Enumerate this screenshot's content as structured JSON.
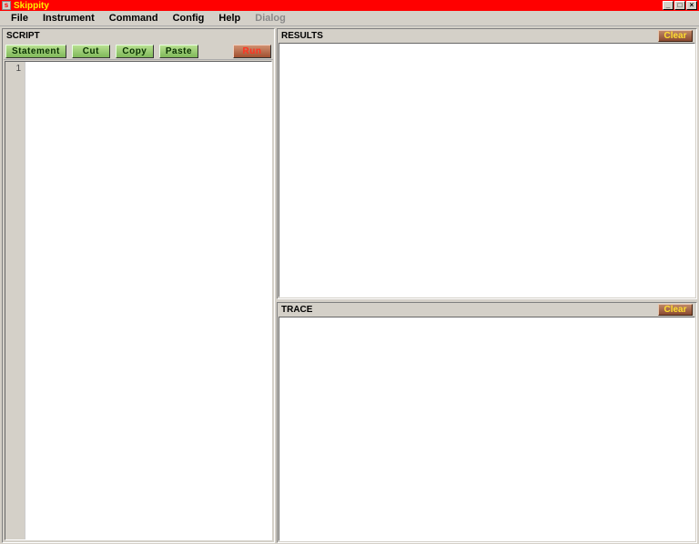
{
  "window": {
    "title": "Skippity"
  },
  "menus": {
    "file": "File",
    "instrument": "Instrument",
    "command": "Command",
    "config": "Config",
    "help": "Help",
    "dialog": "Dialog"
  },
  "script_panel": {
    "title": "SCRIPT",
    "buttons": {
      "statement": "Statement",
      "cut": "Cut",
      "copy": "Copy",
      "paste": "Paste",
      "run": "Run"
    },
    "gutter_first_line": "1",
    "editor_value": ""
  },
  "results_panel": {
    "title": "RESULTS",
    "clear": "Clear",
    "content": ""
  },
  "trace_panel": {
    "title": "TRACE",
    "clear": "Clear",
    "content": ""
  }
}
